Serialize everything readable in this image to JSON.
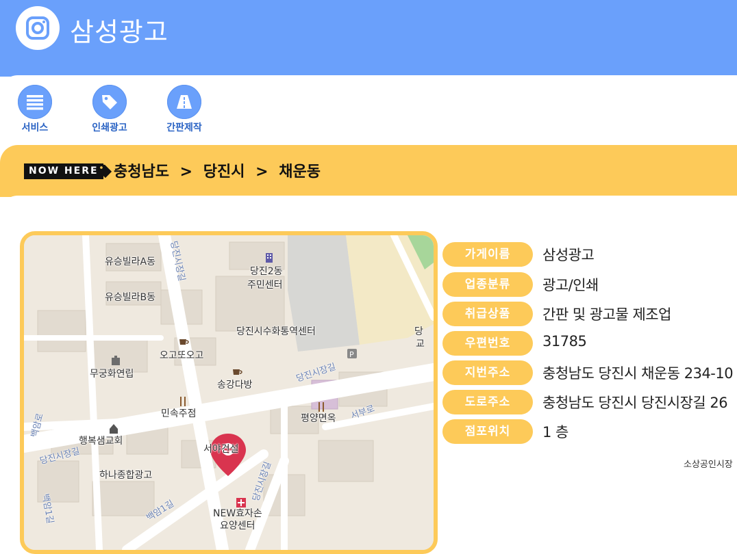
{
  "header": {
    "title": "삼성광고",
    "logo_icon": "instagram-icon",
    "color": "#6aa0fb"
  },
  "nav": [
    {
      "label": "서비스",
      "icon": "list-icon"
    },
    {
      "label": "인쇄광고",
      "icon": "tag-icon"
    },
    {
      "label": "간판제작",
      "icon": "road-icon"
    }
  ],
  "breadcrumb": {
    "badge": "NOW HERE",
    "icon": "tag-icon",
    "items": [
      "충청남도",
      ">",
      "당진시",
      ">",
      "채운동"
    ]
  },
  "map": {
    "marker_label": "서야건설",
    "places": [
      "유승빌라A동",
      "유승빌라B동",
      "당진2동",
      "주민센터",
      "당진시수화통역센터",
      "오고또오고",
      "무궁화연립",
      "송강다방",
      "민속주점",
      "행복샘교회",
      "하나종합광고",
      "평양면옥",
      "NEW효자손",
      "요양센터",
      "당",
      "교"
    ],
    "roads": [
      "당진시장길",
      "당진시장길",
      "당진시장길",
      "당진시장길",
      "서부로",
      "백암로",
      "백암1길",
      "백암1길"
    ]
  },
  "store_info": [
    {
      "label": "가게이름",
      "value": "삼성광고"
    },
    {
      "label": "업종분류",
      "value": "광고/인쇄"
    },
    {
      "label": "취급상품",
      "value": "간판 및 광고물 제조업"
    },
    {
      "label": "우편번호",
      "value": "31785"
    },
    {
      "label": "지번주소",
      "value": "충청남도 당진시 채운동 234-10"
    },
    {
      "label": "도로주소",
      "value": "충청남도 당진시 당진시장길 26"
    },
    {
      "label": "점포위치",
      "value": "1 층"
    }
  ],
  "source_note": "소상공인시장",
  "colors": {
    "accent_blue": "#6aa0fb",
    "accent_yellow": "#fdca59",
    "marker_red": "#d9344f"
  }
}
